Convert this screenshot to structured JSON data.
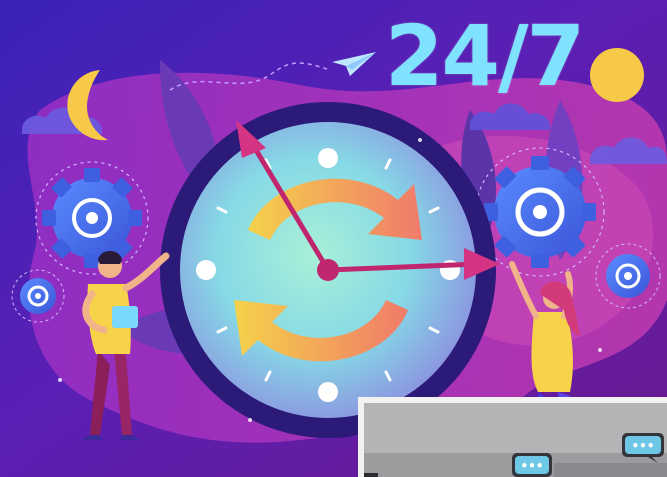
{
  "illustration": {
    "headline": "24/7",
    "colors": {
      "background": "#4a1ea8",
      "accent_cyan": "#7fe3ff",
      "accent_yellow": "#f7c948",
      "accent_pink": "#e0408a"
    }
  },
  "photo": {
    "chat_icon_symbol": "•••"
  }
}
